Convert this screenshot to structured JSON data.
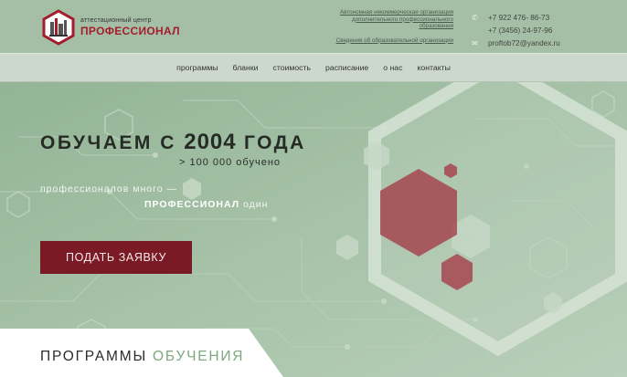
{
  "header": {
    "logo_small": "аттестационный центр",
    "logo_big": "ПРОФЕССИОНАЛ",
    "org_lines": [
      "Автономная некоммерческая организация",
      "дополнительного профессионального",
      "образования"
    ],
    "org_link": "Сведения об образовательной организации",
    "contacts": {
      "phone1": "+7 922 476- 86-73",
      "phone2": "+7 (3456) 24-97-96",
      "email": "proftob72@yandex.ru"
    }
  },
  "nav": {
    "items": [
      "программы",
      "бланки",
      "стоимость",
      "расписание",
      "о нас",
      "контакты"
    ]
  },
  "hero": {
    "title_prefix": "ОБУЧАЕМ С",
    "title_year": "2004",
    "title_suffix": "ГОДА",
    "subtitle": "> 100 000 обучено",
    "line2": "профессионалов много —",
    "line3_bold": "ПРОФЕССИОНАЛ",
    "line3_rest": "один",
    "cta_label": "ПОДАТЬ ЗАЯВКУ"
  },
  "programs": {
    "title_a": "ПРОГРАММЫ",
    "title_b": "ОБУЧЕНИЯ"
  },
  "colors": {
    "accent_red": "#a31e2d",
    "cta_bg": "#7a1a24",
    "hero_bg": "#9fbba1",
    "nav_bg": "#cdd8cd",
    "green_text": "#7da97d"
  }
}
